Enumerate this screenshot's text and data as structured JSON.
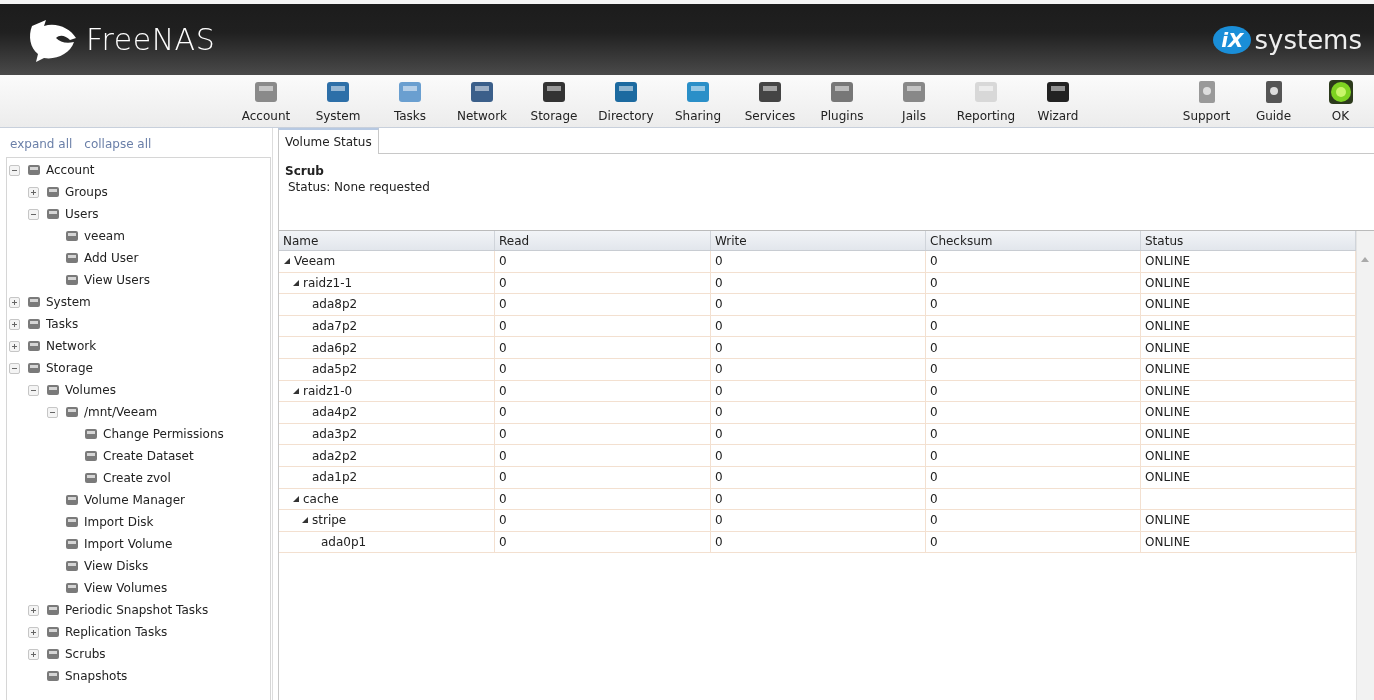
{
  "header": {
    "product": "FreeNAS",
    "vendor_prefix": "iX",
    "vendor": "systems"
  },
  "toolbar": {
    "main": [
      {
        "label": "Account"
      },
      {
        "label": "System"
      },
      {
        "label": "Tasks"
      },
      {
        "label": "Network"
      },
      {
        "label": "Storage"
      },
      {
        "label": "Directory"
      },
      {
        "label": "Sharing"
      },
      {
        "label": "Services"
      },
      {
        "label": "Plugins"
      },
      {
        "label": "Jails"
      },
      {
        "label": "Reporting"
      },
      {
        "label": "Wizard"
      }
    ],
    "extra": [
      {
        "label": "Support"
      },
      {
        "label": "Guide"
      },
      {
        "label": "OK"
      }
    ]
  },
  "sidebar": {
    "links": [
      "expand all",
      "collapse all"
    ],
    "tree": [
      {
        "label": "Account",
        "expanded": true,
        "children": [
          {
            "label": "Groups",
            "expanded": false
          },
          {
            "label": "Users",
            "expanded": true,
            "children": [
              {
                "label": "veeam"
              },
              {
                "label": "Add User"
              },
              {
                "label": "View Users"
              }
            ]
          }
        ]
      },
      {
        "label": "System",
        "expanded": false
      },
      {
        "label": "Tasks",
        "expanded": false
      },
      {
        "label": "Network",
        "expanded": false
      },
      {
        "label": "Storage",
        "expanded": true,
        "children": [
          {
            "label": "Volumes",
            "expanded": true,
            "children": [
              {
                "label": "/mnt/Veeam",
                "expanded": true,
                "children": [
                  {
                    "label": "Change Permissions"
                  },
                  {
                    "label": "Create Dataset"
                  },
                  {
                    "label": "Create zvol"
                  }
                ]
              },
              {
                "label": "Volume Manager"
              },
              {
                "label": "Import Disk"
              },
              {
                "label": "Import Volume"
              },
              {
                "label": "View Disks"
              },
              {
                "label": "View Volumes"
              }
            ]
          },
          {
            "label": "Periodic Snapshot Tasks",
            "expanded": false
          },
          {
            "label": "Replication Tasks",
            "expanded": false
          },
          {
            "label": "Scrubs",
            "expanded": false
          },
          {
            "label": "Snapshots"
          }
        ]
      }
    ]
  },
  "tabs": [
    {
      "label": "Volume Status",
      "selected": true
    }
  ],
  "scrub": {
    "title": "Scrub",
    "status": "Status: None requested"
  },
  "table": {
    "columns": [
      "Name",
      "Read",
      "Write",
      "Checksum",
      "Status"
    ],
    "rows": [
      {
        "name": "Veeam",
        "read": "0",
        "write": "0",
        "checksum": "0",
        "status": "ONLINE",
        "expanded": true,
        "children": [
          {
            "name": "raidz1-1",
            "read": "0",
            "write": "0",
            "checksum": "0",
            "status": "ONLINE",
            "expanded": true,
            "children": [
              {
                "name": "ada8p2",
                "read": "0",
                "write": "0",
                "checksum": "0",
                "status": "ONLINE"
              },
              {
                "name": "ada7p2",
                "read": "0",
                "write": "0",
                "checksum": "0",
                "status": "ONLINE"
              },
              {
                "name": "ada6p2",
                "read": "0",
                "write": "0",
                "checksum": "0",
                "status": "ONLINE"
              },
              {
                "name": "ada5p2",
                "read": "0",
                "write": "0",
                "checksum": "0",
                "status": "ONLINE"
              }
            ]
          },
          {
            "name": "raidz1-0",
            "read": "0",
            "write": "0",
            "checksum": "0",
            "status": "ONLINE",
            "expanded": true,
            "children": [
              {
                "name": "ada4p2",
                "read": "0",
                "write": "0",
                "checksum": "0",
                "status": "ONLINE"
              },
              {
                "name": "ada3p2",
                "read": "0",
                "write": "0",
                "checksum": "0",
                "status": "ONLINE"
              },
              {
                "name": "ada2p2",
                "read": "0",
                "write": "0",
                "checksum": "0",
                "status": "ONLINE"
              },
              {
                "name": "ada1p2",
                "read": "0",
                "write": "0",
                "checksum": "0",
                "status": "ONLINE"
              }
            ]
          },
          {
            "name": "cache",
            "read": "0",
            "write": "0",
            "checksum": "0",
            "expanded": true,
            "children": [
              {
                "name": "stripe",
                "read": "0",
                "write": "0",
                "checksum": "0",
                "status": "ONLINE",
                "expanded": true,
                "children": [
                  {
                    "name": "ada0p1",
                    "read": "0",
                    "write": "0",
                    "checksum": "0",
                    "status": "ONLINE"
                  }
                ]
              }
            ]
          }
        ]
      }
    ]
  }
}
